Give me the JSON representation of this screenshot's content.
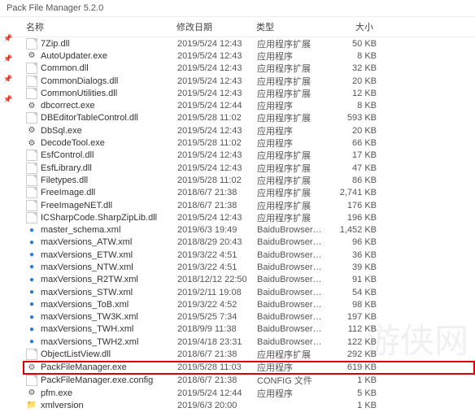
{
  "title": "Pack File Manager 5.2.0",
  "columns": {
    "name": "名称",
    "date": "修改日期",
    "type": "类型",
    "size": "大小"
  },
  "icons": {
    "dll": "",
    "exe": "⚙",
    "xml": "●",
    "gear": "⚙",
    "folder": "📁",
    "pin": "📌"
  },
  "files": [
    {
      "icon": "dll",
      "name": "7Zip.dll",
      "date": "2019/5/24 12:43",
      "type": "应用程序扩展",
      "size": "50 KB"
    },
    {
      "icon": "exe",
      "name": "AutoUpdater.exe",
      "date": "2019/5/24 12:43",
      "type": "应用程序",
      "size": "8 KB"
    },
    {
      "icon": "dll",
      "name": "Common.dll",
      "date": "2019/5/24 12:43",
      "type": "应用程序扩展",
      "size": "32 KB"
    },
    {
      "icon": "dll",
      "name": "CommonDialogs.dll",
      "date": "2019/5/24 12:43",
      "type": "应用程序扩展",
      "size": "20 KB"
    },
    {
      "icon": "dll",
      "name": "CommonUtilities.dll",
      "date": "2019/5/24 12:43",
      "type": "应用程序扩展",
      "size": "12 KB"
    },
    {
      "icon": "exe",
      "name": "dbcorrect.exe",
      "date": "2019/5/24 12:44",
      "type": "应用程序",
      "size": "8 KB"
    },
    {
      "icon": "dll",
      "name": "DBEditorTableControl.dll",
      "date": "2019/5/28 11:02",
      "type": "应用程序扩展",
      "size": "593 KB"
    },
    {
      "icon": "exe",
      "name": "DbSql.exe",
      "date": "2019/5/24 12:43",
      "type": "应用程序",
      "size": "20 KB"
    },
    {
      "icon": "exe",
      "name": "DecodeTool.exe",
      "date": "2019/5/28 11:02",
      "type": "应用程序",
      "size": "66 KB"
    },
    {
      "icon": "dll",
      "name": "EsfControl.dll",
      "date": "2019/5/24 12:43",
      "type": "应用程序扩展",
      "size": "17 KB"
    },
    {
      "icon": "dll",
      "name": "EsfLibrary.dll",
      "date": "2019/5/24 12:43",
      "type": "应用程序扩展",
      "size": "47 KB"
    },
    {
      "icon": "dll",
      "name": "Filetypes.dll",
      "date": "2019/5/28 11:02",
      "type": "应用程序扩展",
      "size": "86 KB"
    },
    {
      "icon": "dll",
      "name": "FreeImage.dll",
      "date": "2018/6/7 21:38",
      "type": "应用程序扩展",
      "size": "2,741 KB"
    },
    {
      "icon": "dll",
      "name": "FreeImageNET.dll",
      "date": "2018/6/7 21:38",
      "type": "应用程序扩展",
      "size": "176 KB"
    },
    {
      "icon": "dll",
      "name": "ICSharpCode.SharpZipLib.dll",
      "date": "2019/5/24 12:43",
      "type": "应用程序扩展",
      "size": "196 KB"
    },
    {
      "icon": "xml",
      "name": "master_schema.xml",
      "date": "2019/6/3 19:49",
      "type": "BaiduBrowser H...",
      "size": "1,452 KB"
    },
    {
      "icon": "xml",
      "name": "maxVersions_ATW.xml",
      "date": "2018/8/29 20:43",
      "type": "BaiduBrowser H...",
      "size": "96 KB"
    },
    {
      "icon": "xml",
      "name": "maxVersions_ETW.xml",
      "date": "2019/3/22 4:51",
      "type": "BaiduBrowser H...",
      "size": "36 KB"
    },
    {
      "icon": "xml",
      "name": "maxVersions_NTW.xml",
      "date": "2019/3/22 4:51",
      "type": "BaiduBrowser H...",
      "size": "39 KB"
    },
    {
      "icon": "xml",
      "name": "maxVersions_R2TW.xml",
      "date": "2018/12/12 22:50",
      "type": "BaiduBrowser H...",
      "size": "91 KB"
    },
    {
      "icon": "xml",
      "name": "maxVersions_STW.xml",
      "date": "2019/2/11 19:08",
      "type": "BaiduBrowser H...",
      "size": "54 KB"
    },
    {
      "icon": "xml",
      "name": "maxVersions_ToB.xml",
      "date": "2019/3/22 4:52",
      "type": "BaiduBrowser H...",
      "size": "98 KB"
    },
    {
      "icon": "xml",
      "name": "maxVersions_TW3K.xml",
      "date": "2019/5/25 7:34",
      "type": "BaiduBrowser H...",
      "size": "197 KB"
    },
    {
      "icon": "xml",
      "name": "maxVersions_TWH.xml",
      "date": "2018/9/9 11:38",
      "type": "BaiduBrowser H...",
      "size": "112 KB"
    },
    {
      "icon": "xml",
      "name": "maxVersions_TWH2.xml",
      "date": "2019/4/18 23:31",
      "type": "BaiduBrowser H...",
      "size": "122 KB"
    },
    {
      "icon": "dll",
      "name": "ObjectListView.dll",
      "date": "2018/6/7 21:38",
      "type": "应用程序扩展",
      "size": "292 KB"
    },
    {
      "icon": "gear",
      "name": "PackFileManager.exe",
      "date": "2019/5/28 11:03",
      "type": "应用程序",
      "size": "619 KB",
      "highlight": true
    },
    {
      "icon": "dll",
      "name": "PackFileManager.exe.config",
      "date": "2018/6/7 21:38",
      "type": "CONFIG 文件",
      "size": "1 KB"
    },
    {
      "icon": "exe",
      "name": "pfm.exe",
      "date": "2019/5/24 12:44",
      "type": "应用程序",
      "size": "5 KB"
    },
    {
      "icon": "folder",
      "name": "xmlversion",
      "date": "2019/6/3 20:00",
      "type": "",
      "size": "1 KB"
    }
  ],
  "watermark": "游侠网"
}
